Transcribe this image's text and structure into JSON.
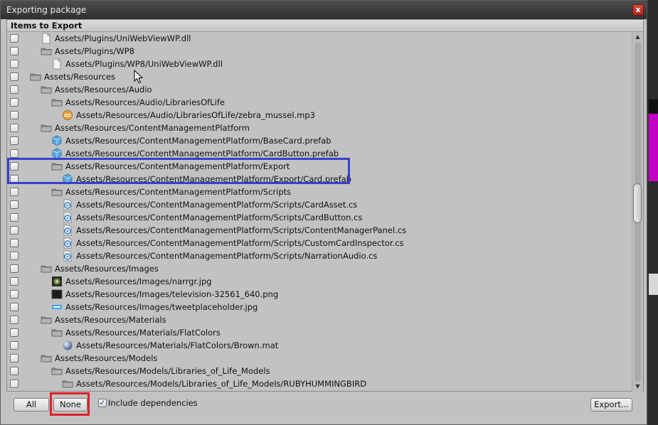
{
  "window": {
    "title": "Exporting package",
    "close_glyph": "x"
  },
  "panel": {
    "header": "Items to Export"
  },
  "tree": {
    "rows": [
      {
        "indent": 2,
        "icon": "file-icon",
        "label": "Assets/Plugins/UniWebViewWP.dll"
      },
      {
        "indent": 2,
        "icon": "folder-icon",
        "label": "Assets/Plugins/WP8"
      },
      {
        "indent": 3,
        "icon": "file-icon",
        "label": "Assets/Plugins/WP8/UniWebViewWP.dll"
      },
      {
        "indent": 1,
        "icon": "folder-icon",
        "label": "Assets/Resources"
      },
      {
        "indent": 2,
        "icon": "folder-icon",
        "label": "Assets/Resources/Audio"
      },
      {
        "indent": 3,
        "icon": "folder-icon",
        "label": "Assets/Resources/Audio/LibrariesOfLife"
      },
      {
        "indent": 4,
        "icon": "audio-icon",
        "label": "Assets/Resources/Audio/LibrariesOfLife/zebra_mussel.mp3"
      },
      {
        "indent": 2,
        "icon": "folder-icon",
        "label": "Assets/Resources/ContentManagementPlatform"
      },
      {
        "indent": 3,
        "icon": "prefab-icon",
        "label": "Assets/Resources/ContentManagementPlatform/BaseCard.prefab"
      },
      {
        "indent": 3,
        "icon": "prefab-icon",
        "label": "Assets/Resources/ContentManagementPlatform/CardButton.prefab"
      },
      {
        "indent": 3,
        "icon": "folder-icon",
        "label": "Assets/Resources/ContentManagementPlatform/Export"
      },
      {
        "indent": 4,
        "icon": "prefab-icon",
        "label": "Assets/Resources/ContentManagementPlatform/Export/Card.prefab"
      },
      {
        "indent": 3,
        "icon": "folder-icon",
        "label": "Assets/Resources/ContentManagementPlatform/Scripts"
      },
      {
        "indent": 4,
        "icon": "csharp-icon",
        "label": "Assets/Resources/ContentManagementPlatform/Scripts/CardAsset.cs"
      },
      {
        "indent": 4,
        "icon": "csharp-icon",
        "label": "Assets/Resources/ContentManagementPlatform/Scripts/CardButton.cs"
      },
      {
        "indent": 4,
        "icon": "csharp-icon",
        "label": "Assets/Resources/ContentManagementPlatform/Scripts/ContentManagerPanel.cs"
      },
      {
        "indent": 4,
        "icon": "csharp-icon",
        "label": "Assets/Resources/ContentManagementPlatform/Scripts/CustomCardInspector.cs"
      },
      {
        "indent": 4,
        "icon": "csharp-icon",
        "label": "Assets/Resources/ContentManagementPlatform/Scripts/NarrationAudio.cs"
      },
      {
        "indent": 2,
        "icon": "folder-icon",
        "label": "Assets/Resources/Images"
      },
      {
        "indent": 3,
        "icon": "image-thumb-icon",
        "label": "Assets/Resources/Images/narrgr.jpg"
      },
      {
        "indent": 3,
        "icon": "image-dark-icon",
        "label": "Assets/Resources/Images/television-32561_640.png"
      },
      {
        "indent": 3,
        "icon": "image-tweet-icon",
        "label": "Assets/Resources/Images/tweetplaceholder.jpg"
      },
      {
        "indent": 2,
        "icon": "folder-icon",
        "label": "Assets/Resources/Materials"
      },
      {
        "indent": 3,
        "icon": "folder-icon",
        "label": "Assets/Resources/Materials/FlatColors"
      },
      {
        "indent": 4,
        "icon": "material-icon",
        "label": "Assets/Resources/Materials/FlatColors/Brown.mat"
      },
      {
        "indent": 2,
        "icon": "folder-icon",
        "label": "Assets/Resources/Models"
      },
      {
        "indent": 3,
        "icon": "folder-icon",
        "label": "Assets/Resources/Models/Libraries_of_Life_Models"
      },
      {
        "indent": 4,
        "icon": "folder-icon",
        "label": "Assets/Resources/Models/Libraries_of_Life_Models/RUBYHUMMINGBIRD"
      }
    ]
  },
  "scrollbar": {
    "position_fraction": 0.47
  },
  "footer": {
    "all_label": "All",
    "none_label": "None",
    "include_dependencies_label": "Include dependencies",
    "include_dependencies_checked": true,
    "export_label": "Export..."
  },
  "colors": {
    "highlight_box": "#3a3fd0",
    "annotation_red": "#e0202a"
  }
}
